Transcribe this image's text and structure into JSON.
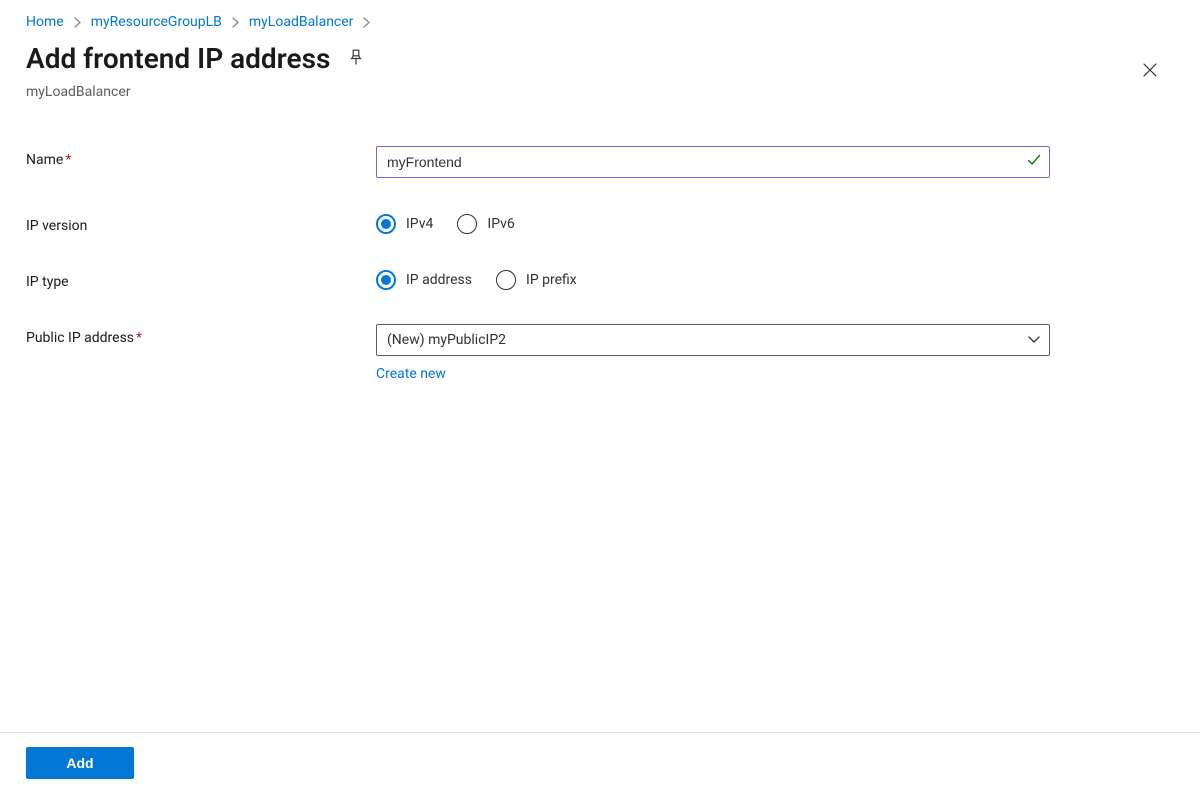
{
  "breadcrumb": {
    "items": [
      "Home",
      "myResourceGroupLB",
      "myLoadBalancer"
    ]
  },
  "header": {
    "title": "Add frontend IP address",
    "subtitle": "myLoadBalancer"
  },
  "form": {
    "name": {
      "label": "Name",
      "required": true,
      "value": "myFrontend"
    },
    "ip_version": {
      "label": "IP version",
      "options": [
        "IPv4",
        "IPv6"
      ],
      "selected": "IPv4"
    },
    "ip_type": {
      "label": "IP type",
      "options": [
        "IP address",
        "IP prefix"
      ],
      "selected": "IP address"
    },
    "public_ip": {
      "label": "Public IP address",
      "required": true,
      "value": "(New) myPublicIP2",
      "create_new": "Create new"
    }
  },
  "footer": {
    "add_label": "Add"
  }
}
